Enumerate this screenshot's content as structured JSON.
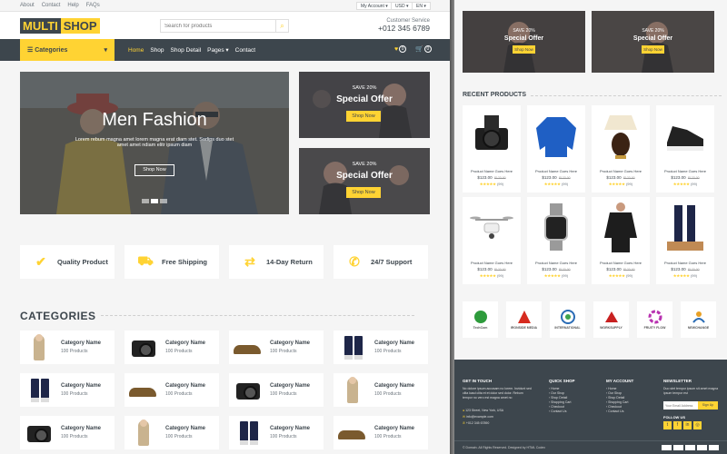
{
  "colors": {
    "primary": "#FFD333",
    "dark": "#3D464D",
    "bg": "#F5F5F5"
  },
  "topbar": {
    "links": [
      "About",
      "Contact",
      "Help",
      "FAQs"
    ],
    "account": "My Account",
    "currency": "USD",
    "language": "EN"
  },
  "logo": {
    "part1": "MULTI",
    "part2": "SHOP"
  },
  "search": {
    "placeholder": "Search for products"
  },
  "customer_service": {
    "label": "Customer Service",
    "phone": "+012 345 6789"
  },
  "nav": {
    "categories_label": "Categories",
    "items": [
      "Home",
      "Shop",
      "Shop Detail",
      "Pages",
      "Contact"
    ],
    "wishlist_count": "0",
    "cart_count": "0"
  },
  "hero": {
    "title": "Men Fashion",
    "subtitle": "Lorem rebum magna amet lorem magna erat diam stet. Sadips duo stet amet amet ndiam elitr ipsum diam",
    "button": "Shop Now"
  },
  "offers": [
    {
      "save": "SAVE 20%",
      "title": "Special Offer",
      "button": "Shop Now"
    },
    {
      "save": "SAVE 20%",
      "title": "Special Offer",
      "button": "Shop Now"
    }
  ],
  "features": [
    {
      "icon": "check-icon",
      "label": "Quality Product"
    },
    {
      "icon": "truck-icon",
      "label": "Free Shipping"
    },
    {
      "icon": "exchange-icon",
      "label": "14-Day Return"
    },
    {
      "icon": "phone-volume-icon",
      "label": "24/7 Support"
    }
  ],
  "categories": {
    "heading": "CATEGORIES",
    "items": [
      {
        "name": "Category Name",
        "count": "100 Products",
        "image": "woman-sweater"
      },
      {
        "name": "Category Name",
        "count": "100 Products",
        "image": "camera"
      },
      {
        "name": "Category Name",
        "count": "100 Products",
        "image": "shoes"
      },
      {
        "name": "Category Name",
        "count": "100 Products",
        "image": "cosmetics"
      },
      {
        "name": "Category Name",
        "count": "100 Products",
        "image": "cosmetics"
      },
      {
        "name": "Category Name",
        "count": "100 Products",
        "image": "shoes"
      },
      {
        "name": "Category Name",
        "count": "100 Products",
        "image": "camera"
      },
      {
        "name": "Category Name",
        "count": "100 Products",
        "image": "woman-sweater"
      },
      {
        "name": "Category Name",
        "count": "100 Products",
        "image": "camera"
      },
      {
        "name": "Category Name",
        "count": "100 Products",
        "image": "woman-sweater"
      },
      {
        "name": "Category Name",
        "count": "100 Products",
        "image": "cosmetics"
      },
      {
        "name": "Category Name",
        "count": "100 Products",
        "image": "shoes"
      }
    ]
  },
  "right_offers": [
    {
      "save": "SAVE 20%",
      "title": "Special Offer",
      "button": "Shop Now"
    },
    {
      "save": "SAVE 20%",
      "title": "Special Offer",
      "button": "Shop Now"
    }
  ],
  "recent_products": {
    "heading": "RECENT PRODUCTS",
    "items": [
      {
        "name": "Product Name Goes Here",
        "price": "$123.00",
        "old_price": "$123.00",
        "stars": "★★★★★",
        "reviews": "(99)",
        "image": "camera"
      },
      {
        "name": "Product Name Goes Here",
        "price": "$123.00",
        "old_price": "$123.00",
        "stars": "★★★★★",
        "reviews": "(99)",
        "image": "blue-sweater"
      },
      {
        "name": "Product Name Goes Here",
        "price": "$123.00",
        "old_price": "$123.00",
        "stars": "★★★★★",
        "reviews": "(99)",
        "image": "lamp"
      },
      {
        "name": "Product Name Goes Here",
        "price": "$123.00",
        "old_price": "$123.00",
        "stars": "★★★★★",
        "reviews": "(99)",
        "image": "sneaker"
      },
      {
        "name": "Product Name Goes Here",
        "price": "$123.00",
        "old_price": "$123.00",
        "stars": "★★★★★",
        "reviews": "(99)",
        "image": "drone"
      },
      {
        "name": "Product Name Goes Here",
        "price": "$123.00",
        "old_price": "$123.00",
        "stars": "★★★★★",
        "reviews": "(99)",
        "image": "watch"
      },
      {
        "name": "Product Name Goes Here",
        "price": "$123.00",
        "old_price": "$123.00",
        "stars": "★★★★★",
        "reviews": "(99)",
        "image": "woman-blouse"
      },
      {
        "name": "Product Name Goes Here",
        "price": "$123.00",
        "old_price": "$123.00",
        "stars": "★★★★★",
        "reviews": "(99)",
        "image": "cosmetics"
      }
    ]
  },
  "brands": [
    {
      "name": "TechCom",
      "color": "#2e9b3c"
    },
    {
      "name": "IRONSIDE MEDIA",
      "color": "#d62b1f"
    },
    {
      "name": "INTERNATIONAL",
      "color": "#2a6cb5"
    },
    {
      "name": "WORKSUPPLY",
      "color": "#c82020"
    },
    {
      "name": "FRUITY FLOW",
      "color": "#b832b0"
    },
    {
      "name": "NEWCHANGE",
      "color": "#e8a025"
    }
  ],
  "footer": {
    "get_in_touch": {
      "heading": "GET IN TOUCH",
      "text": "No dolore ipsum accusam no lorem. Invidunt sed clita kasd clita et et dolor sed dolor. Rebum tempor no vero est magna amet no",
      "address": "123 Street, New York, USA",
      "email": "info@example.com",
      "phone": "+012 345 67890"
    },
    "quick_shop": {
      "heading": "QUICK SHOP",
      "links": [
        "Home",
        "Our Shop",
        "Shop Detail",
        "Shopping Cart",
        "Checkout",
        "Contact Us"
      ]
    },
    "my_account": {
      "heading": "MY ACCOUNT",
      "links": [
        "Home",
        "Our Shop",
        "Shop Detail",
        "Shopping Cart",
        "Checkout",
        "Contact Us"
      ]
    },
    "newsletter": {
      "heading": "NEWSLETTER",
      "text": "Duo stet tempor ipsum sit amet magna ipsum tempor est",
      "placeholder": "Your Email Address",
      "button": "Sign Up",
      "follow": "FOLLOW US"
    },
    "copyright": "© Domain. All Rights Reserved. Designed by HTML Codex"
  }
}
